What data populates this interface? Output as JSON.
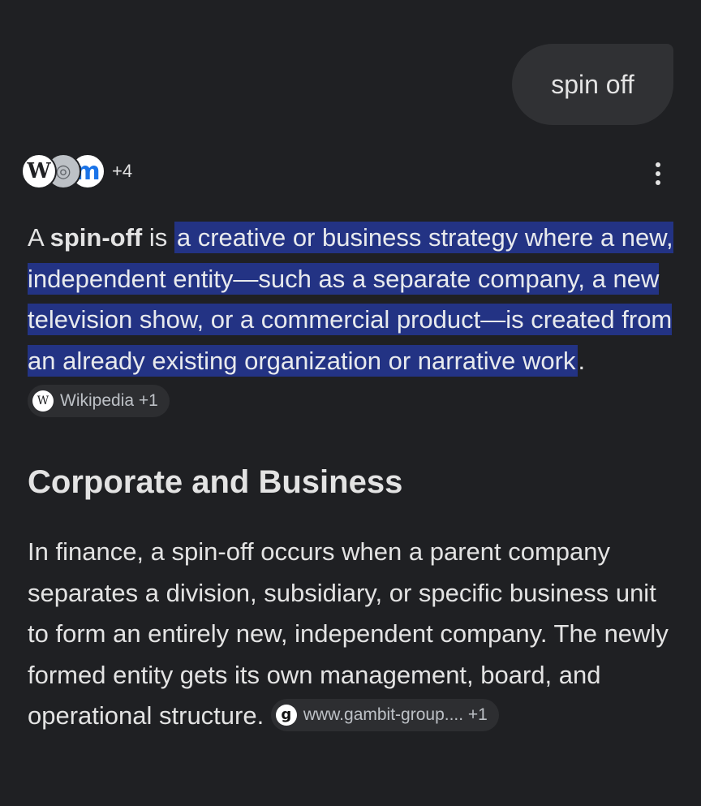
{
  "query": "spin off",
  "sources": {
    "icons": [
      "wikipedia-icon",
      "globe-icon",
      "m-icon"
    ],
    "more_count": "+4"
  },
  "answer": {
    "prefix": "A ",
    "term": "spin-off",
    "is": " is ",
    "highlight": "a creative or business strategy where a new, independent entity—such as a separate company, a new television show, or a commercial product—is created from an already existing organization or narrative work",
    "period": ".",
    "citation": {
      "label": "Wikipedia +1",
      "icon": "wikipedia-icon"
    }
  },
  "section": {
    "title": "Corporate and Business",
    "body": "In finance, a spin-off occurs when a parent company separates a division, subsidiary, or specific business unit to form an entirely new, independent company. The newly formed entity gets its own management, board, and operational structure.",
    "citation": {
      "label": "www.gambit-group.... +1",
      "icon": "gambit-icon"
    }
  },
  "colors": {
    "background": "#1f2023",
    "highlight": "#233384",
    "bubble": "#303134"
  }
}
